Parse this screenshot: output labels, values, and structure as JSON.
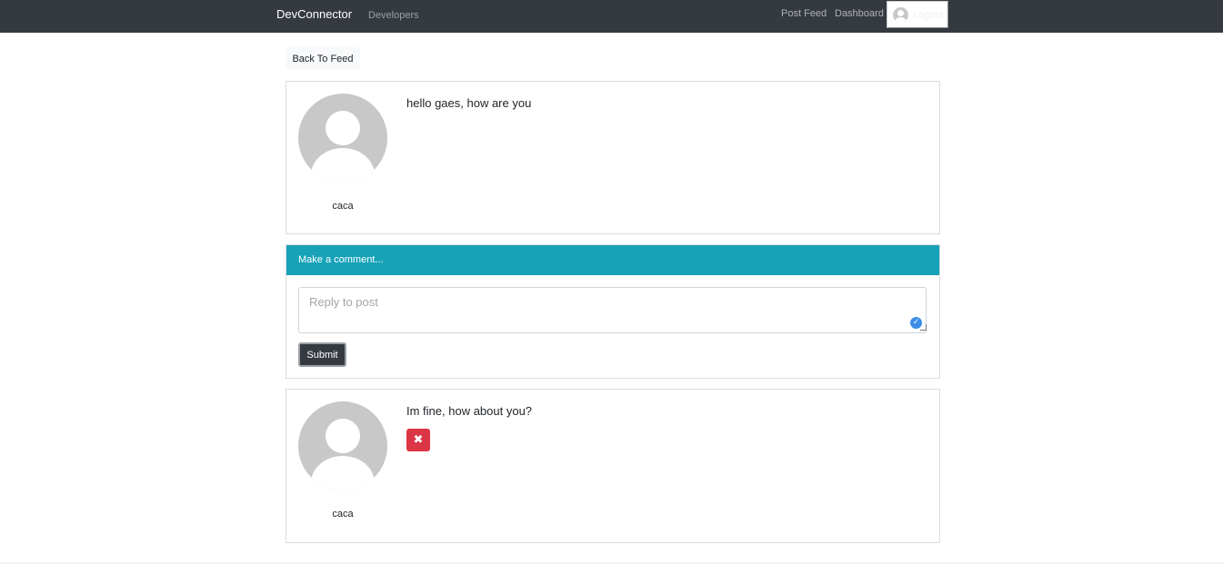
{
  "navbar": {
    "brand": "DevConnector",
    "developers": "Developers",
    "post_feed": "Post Feed",
    "dashboard": "Dashboard",
    "logout": "Logout"
  },
  "back_button": "Back To Feed",
  "post": {
    "text": "hello gaes, how are you",
    "author": "caca"
  },
  "comment_form": {
    "header": "Make a comment...",
    "placeholder": "Reply to post",
    "submit": "Submit"
  },
  "comments": [
    {
      "text": "Im fine, how about you?",
      "author": "caca",
      "delete_icon": "✖"
    }
  ],
  "colors": {
    "navbar": "#343a40",
    "header": "#17a2b8",
    "delete": "#dc3545"
  }
}
